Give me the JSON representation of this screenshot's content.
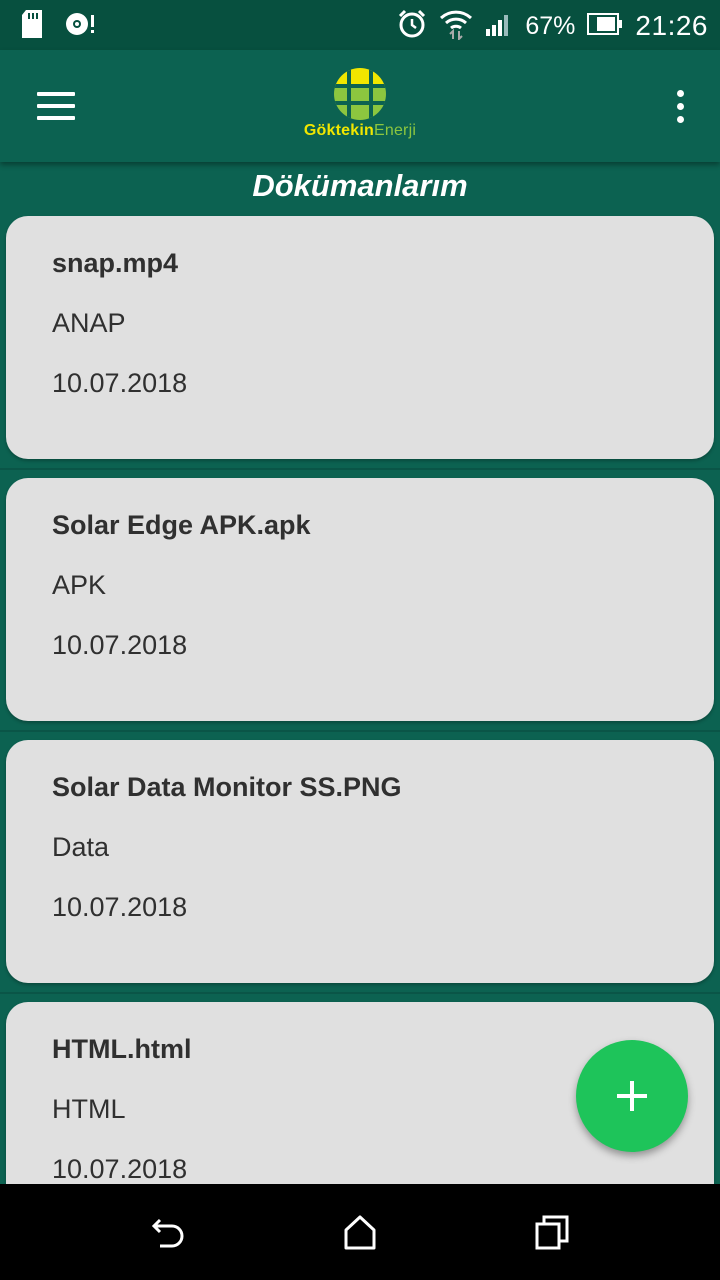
{
  "status_bar": {
    "battery_text": "67%",
    "time": "21:26",
    "icons": [
      "sd-card-icon",
      "sync-icon",
      "alarm-icon",
      "wifi-icon",
      "signal-icon",
      "battery-icon"
    ]
  },
  "app_bar": {
    "logo_text_part1": "Göktekin",
    "logo_text_part2": "Enerji",
    "menu_icon": "hamburger-menu-icon",
    "more_icon": "more-vertical-icon"
  },
  "page": {
    "title": "Dökümanlarım"
  },
  "documents": [
    {
      "name": "snap.mp4",
      "category": "ANAP",
      "date": "10.07.2018"
    },
    {
      "name": "Solar Edge APK.apk",
      "category": "APK",
      "date": "10.07.2018"
    },
    {
      "name": "Solar Data Monitor SS.PNG",
      "category": "Data",
      "date": "10.07.2018"
    },
    {
      "name": "HTML.html",
      "category": "HTML",
      "date": "10.07.2018"
    }
  ],
  "fab": {
    "icon": "plus-icon"
  },
  "nav_bar": {
    "icons": [
      "back-icon",
      "home-icon",
      "recents-icon"
    ]
  },
  "colors": {
    "primary": "#0c6251",
    "status_bar": "#07503f",
    "card": "#e0e0e0",
    "fab": "#1ec45a",
    "logo_yellow": "#f1e600",
    "logo_green": "#8cc63f"
  }
}
